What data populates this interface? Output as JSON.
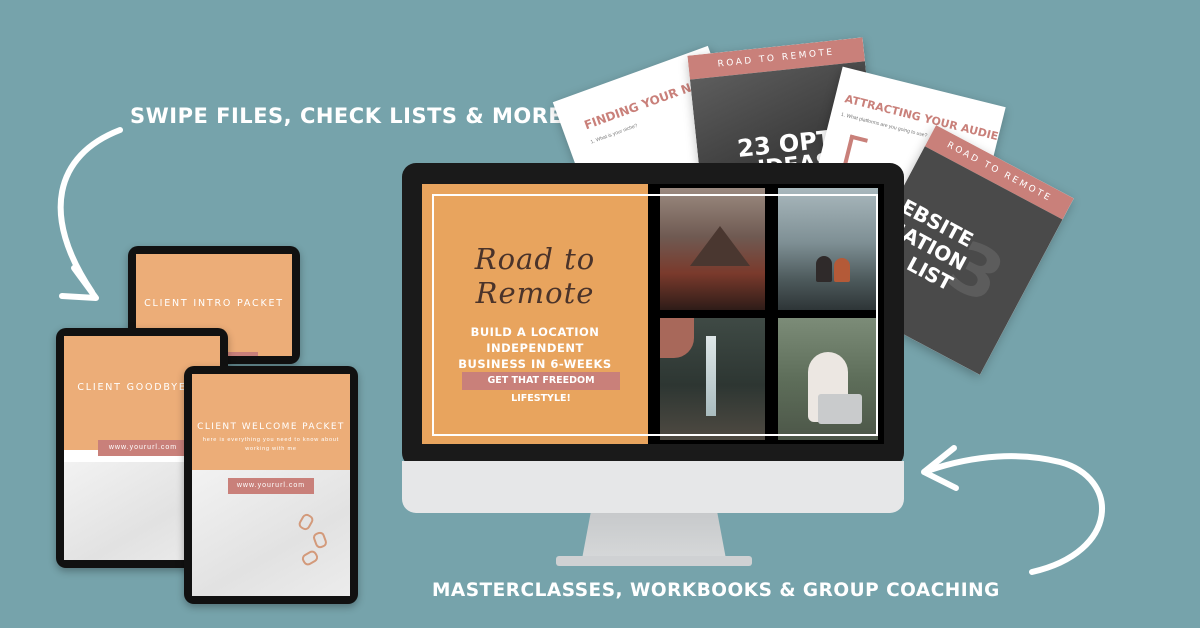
{
  "colors": {
    "background": "#76a3ab",
    "accent_rose": "#c9807a",
    "screen_orange": "#e8a45e",
    "tablet_peach": "#ecad78"
  },
  "captions": {
    "top": "SWIPE FILES, CHECK LISTS & MORE!",
    "bottom": "MASTERCLASSES, WORKBOOKS & GROUP COACHING"
  },
  "screen": {
    "brand": "Road to Remote",
    "tagline_line1": "BUILD A LOCATION INDEPENDENT",
    "tagline_line2": "BUSINESS IN 6-WEEKS",
    "cta": "GET THAT FREEDOM LIFESTYLE!"
  },
  "sheets": {
    "sheet1": {
      "heading": "FINDING YOUR N",
      "small": "1. What is your niche?"
    },
    "sheet2": {
      "band": "ROAD TO REMOTE",
      "big_line1": "23 OPT",
      "big_line2": "IDEAS"
    },
    "sheet3": {
      "heading": "ATTRACTING YOUR AUDIENCE",
      "small": "1. What platforms are you going to use?"
    },
    "sheet4": {
      "band": "ROAD TO REMOTE",
      "number": "3",
      "line1": "EBSITE",
      "line2": "SATION",
      "line3": "LIST"
    }
  },
  "tablets": {
    "intro": {
      "title": "CLIENT INTRO PACKET"
    },
    "goodbye": {
      "title": "CLIENT GOODBYE PA",
      "url": "www.yoururl.com"
    },
    "welcome": {
      "title": "CLIENT WELCOME PACKET",
      "sub_line1": "here is everything you need to know about",
      "sub_line2": "working with me",
      "url": "www.yoururl.com"
    }
  }
}
